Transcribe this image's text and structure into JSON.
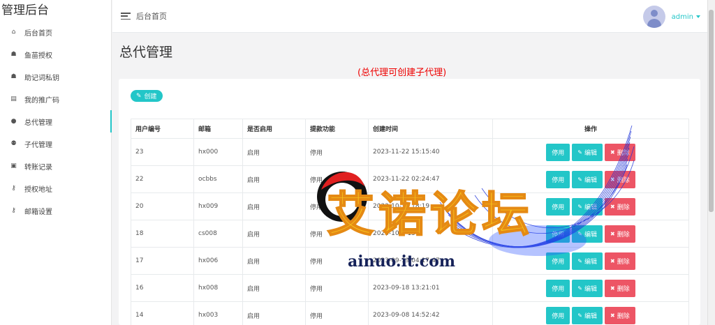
{
  "brand": "管理后台",
  "nav": [
    {
      "label": "后台首页",
      "icon": "home-icon",
      "glyph": "⌂"
    },
    {
      "label": "鱼苗授权",
      "icon": "user-secret-icon",
      "glyph": "☗"
    },
    {
      "label": "助记词私钥",
      "icon": "user-secret-icon",
      "glyph": "☗"
    },
    {
      "label": "我的推广码",
      "icon": "file-icon",
      "glyph": "▤"
    },
    {
      "label": "总代管理",
      "icon": "user-icon",
      "glyph": "●"
    },
    {
      "label": "子代管理",
      "icon": "users-icon",
      "glyph": "⚉"
    },
    {
      "label": "转账记录",
      "icon": "list-icon",
      "glyph": "▣"
    },
    {
      "label": "授权地址",
      "icon": "key-icon",
      "glyph": "⚷"
    },
    {
      "label": "邮箱设置",
      "icon": "key-icon",
      "glyph": "⚷"
    }
  ],
  "header": {
    "breadcrumb": "后台首页",
    "username": "admin"
  },
  "page": {
    "title": "总代管理",
    "notice": "(总代理可创建子代理)",
    "create_label": "创建"
  },
  "table": {
    "headers": [
      "用户编号",
      "邮箱",
      "是否启用",
      "提款功能",
      "创建时间",
      "操作"
    ],
    "actions": {
      "disable": "停用",
      "edit": "编辑",
      "delete": "删除"
    },
    "rows": [
      [
        "23",
        "hx000",
        "启用",
        "停用",
        "2023-11-22 15:15:40"
      ],
      [
        "22",
        "ocbbs",
        "启用",
        "停用",
        "2023-11-22 02:24:47"
      ],
      [
        "20",
        "hx009",
        "启用",
        "停用",
        "2023-10-30 18:19"
      ],
      [
        "18",
        "cs008",
        "启用",
        "停用",
        "2023-10-0  15"
      ],
      [
        "17",
        "hx006",
        "启用",
        "停用",
        "2023-09-19 04:17:47"
      ],
      [
        "16",
        "hx008",
        "启用",
        "停用",
        "2023-09-18 13:21:01"
      ],
      [
        "14",
        "hx003",
        "启用",
        "停用",
        "2023-09-08 14:52:42"
      ]
    ]
  },
  "watermark": {
    "text": "艾诺论坛",
    "domain": "ainuo.it.com"
  },
  "colors": {
    "accent": "#23c6c8",
    "danger": "#ed5565",
    "notice": "#ee0000"
  }
}
